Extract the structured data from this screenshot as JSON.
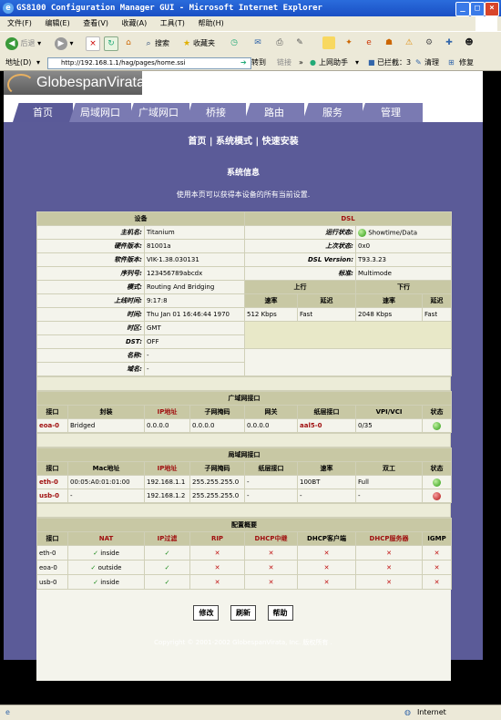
{
  "window": {
    "title": "GS8100 Configuration Manager GUI - Microsoft Internet Explorer"
  },
  "menu": [
    "文件(F)",
    "编辑(E)",
    "查看(V)",
    "收藏(A)",
    "工具(T)",
    "帮助(H)"
  ],
  "toolbar": {
    "back": "后退",
    "search": "搜索",
    "favorites": "收藏夹"
  },
  "address": {
    "label": "地址(D)",
    "url": "http://192.168.1.1/hag/pages/home.ssi",
    "go": "转到",
    "links": "链接",
    "ext1": "上网助手",
    "ext2": "已拦截：3",
    "ext3": "清理",
    "ext4": "修复"
  },
  "logo": "GlobespanVirata",
  "tabs": [
    "首页",
    "局域网口",
    "广域网口",
    "桥接",
    "路由",
    "服务",
    "管理"
  ],
  "toplinks": "首页 | 系统模式 | 快速安装",
  "section_title": "系统信息",
  "section_subtitle": "使用本页可以获得本设备的所有当前设置.",
  "device": {
    "header": "设备",
    "rows": [
      {
        "label": "主机名:",
        "value": "Titanium"
      },
      {
        "label": "硬件版本:",
        "value": "81001a"
      },
      {
        "label": "软件版本:",
        "value": "VIK-1.38.030131"
      },
      {
        "label": "序列号:",
        "value": "123456789abcdx"
      },
      {
        "label": "模式:",
        "value": "Routing And Bridging"
      },
      {
        "label": "上线时间:",
        "value": "9:17:8"
      },
      {
        "label": "时间:",
        "value": "Thu Jan 01 16:46:44 1970"
      },
      {
        "label": "时区:",
        "value": "GMT"
      },
      {
        "label": "DST:",
        "value": "OFF"
      },
      {
        "label": "名称:",
        "value": "-"
      },
      {
        "label": "域名:",
        "value": "-"
      }
    ]
  },
  "dsl": {
    "header": "DSL",
    "rows": [
      {
        "label": "运行状态:",
        "value": "Showtime/Data"
      },
      {
        "label": "上次状态:",
        "value": "0x0"
      },
      {
        "label": "DSL Version:",
        "value": "T93.3.23"
      },
      {
        "label": "标准:",
        "value": "Multimode"
      }
    ],
    "up_label": "上行",
    "down_label": "下行",
    "rate_label": "速率",
    "latency_label": "延迟",
    "up_rate": "512 Kbps",
    "up_latency": "Fast",
    "down_rate": "2048 Kbps",
    "down_latency": "Fast"
  },
  "wan": {
    "title": "广域网接口",
    "headers": [
      "接口",
      "封装",
      "IP地址",
      "子网掩码",
      "网关",
      "纸层接口",
      "VPI/VCI",
      "状态"
    ],
    "rows": [
      {
        "iface": "eoa-0",
        "encap": "Bridged",
        "ip": "0.0.0.0",
        "mask": "0.0.0.0",
        "gateway": "0.0.0.0",
        "lower": "aal5-0",
        "vpivci": "0/35",
        "status": "up"
      }
    ]
  },
  "lan": {
    "title": "局域网接口",
    "headers": [
      "接口",
      "Mac地址",
      "IP地址",
      "子网掩码",
      "纸层接口",
      "速率",
      "双工",
      "状态"
    ],
    "rows": [
      {
        "iface": "eth-0",
        "mac": "00:05:A0:01:01:00",
        "ip": "192.168.1.1",
        "mask": "255.255.255.0",
        "lower": "-",
        "rate": "100BT",
        "duplex": "Full",
        "status": "up"
      },
      {
        "iface": "usb-0",
        "mac": "-",
        "ip": "192.168.1.2",
        "mask": "255.255.255.0",
        "lower": "-",
        "rate": "-",
        "duplex": "-",
        "status": "down"
      }
    ]
  },
  "config": {
    "title": "配置概要",
    "headers": [
      "接口",
      "NAT",
      "IP过滤",
      "RIP",
      "DHCP中继",
      "DHCP客户端",
      "DHCP服务器",
      "IGMP"
    ],
    "rows": [
      {
        "iface": "eth-0",
        "nat": "inside"
      },
      {
        "iface": "eoa-0",
        "nat": "outside"
      },
      {
        "iface": "usb-0",
        "nat": "inside"
      }
    ]
  },
  "buttons": {
    "modify": "修改",
    "refresh": "刷新",
    "help": "帮助"
  },
  "copyright": "Copyright © 2001-2002 GlobespanVirata, Inc. 版权所有 .",
  "statusbar": {
    "zone": "Internet"
  }
}
